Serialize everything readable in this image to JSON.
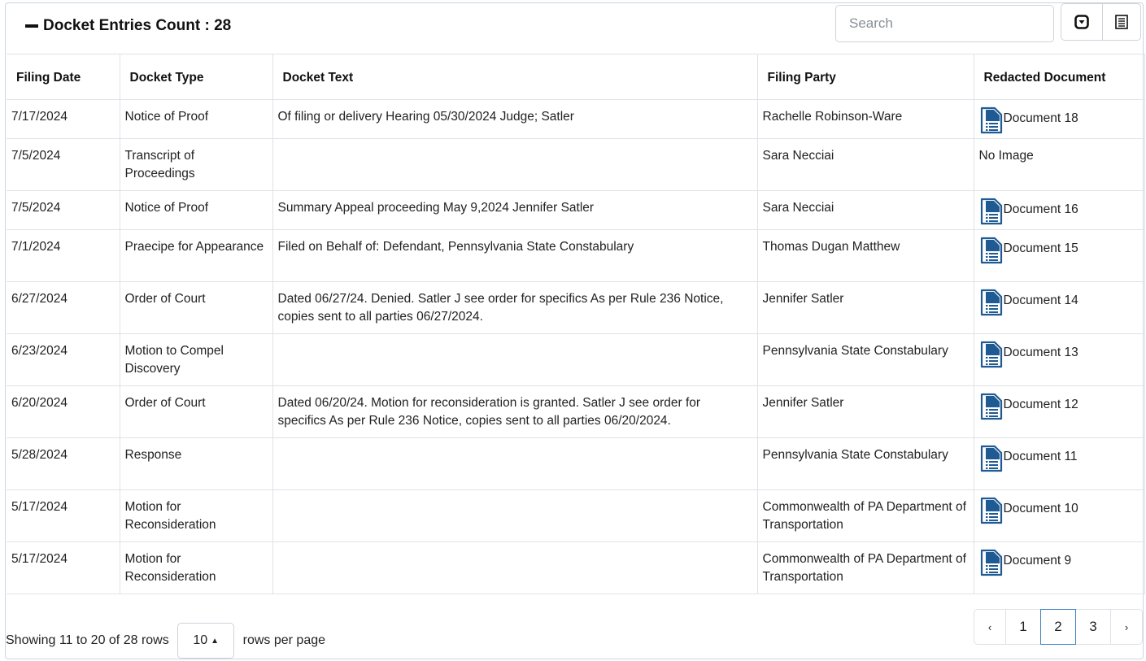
{
  "header": {
    "title": "Docket Entries Count : 28",
    "search_placeholder": "Search"
  },
  "columns": [
    "Filing Date",
    "Docket Type",
    "Docket Text",
    "Filing Party",
    "Redacted Document"
  ],
  "rows": [
    {
      "date": "7/17/2024",
      "type": "Notice of Proof",
      "text": "Of filing or delivery Hearing 05/30/2024 Judge; Satler",
      "party": "Rachelle Robinson-Ware",
      "doc": "Document 18",
      "has_doc": true
    },
    {
      "date": "7/5/2024",
      "type": "Transcript of Proceedings",
      "text": "",
      "party": "Sara Necciai",
      "doc": "No Image",
      "has_doc": false
    },
    {
      "date": "7/5/2024",
      "type": "Notice of Proof",
      "text": "Summary Appeal proceeding May 9,2024 Jennifer Satler",
      "party": "Sara Necciai",
      "doc": "Document 16",
      "has_doc": true
    },
    {
      "date": "7/1/2024",
      "type": "Praecipe for Appearance",
      "text": "Filed on Behalf of: Defendant, Pennsylvania State Constabulary",
      "party": "Thomas Dugan Matthew",
      "doc": "Document 15",
      "has_doc": true
    },
    {
      "date": "6/27/2024",
      "type": "Order of Court",
      "text": "Dated 06/27/24. Denied. Satler J see order for specifics As per Rule 236 Notice, copies sent to all parties 06/27/2024.",
      "party": "Jennifer Satler",
      "doc": "Document 14",
      "has_doc": true
    },
    {
      "date": "6/23/2024",
      "type": "Motion to Compel Discovery",
      "text": "",
      "party": "Pennsylvania State Constabulary",
      "doc": "Document 13",
      "has_doc": true
    },
    {
      "date": "6/20/2024",
      "type": "Order of Court",
      "text": "Dated 06/20/24. Motion for reconsideration is granted. Satler J see order for specifics As per Rule 236 Notice, copies sent to all parties 06/20/2024.",
      "party": "Jennifer Satler",
      "doc": "Document 12",
      "has_doc": true
    },
    {
      "date": "5/28/2024",
      "type": "Response",
      "text": "",
      "party": "Pennsylvania State Constabulary",
      "doc": "Document 11",
      "has_doc": true
    },
    {
      "date": "5/17/2024",
      "type": "Motion for Reconsideration",
      "text": "",
      "party": "Commonwealth of PA Department of Transportation",
      "doc": "Document 10",
      "has_doc": true
    },
    {
      "date": "5/17/2024",
      "type": "Motion for Reconsideration",
      "text": "",
      "party": "Commonwealth of PA Department of Transportation",
      "doc": "Document 9",
      "has_doc": true
    }
  ],
  "footer": {
    "showing": "Showing 11 to 20 of 28 rows",
    "per_page_value": "10",
    "per_page_suffix": "rows per page",
    "pages": [
      "‹",
      "1",
      "2",
      "3",
      "›"
    ],
    "active_page": "2"
  },
  "colors": {
    "icon_blue": "#1f5a92",
    "border": "#dee2e6",
    "active_page_border": "#3b82c4"
  },
  "icons": [
    "minus-icon",
    "toggle-icon",
    "columns-list-icon",
    "document-icon"
  ]
}
